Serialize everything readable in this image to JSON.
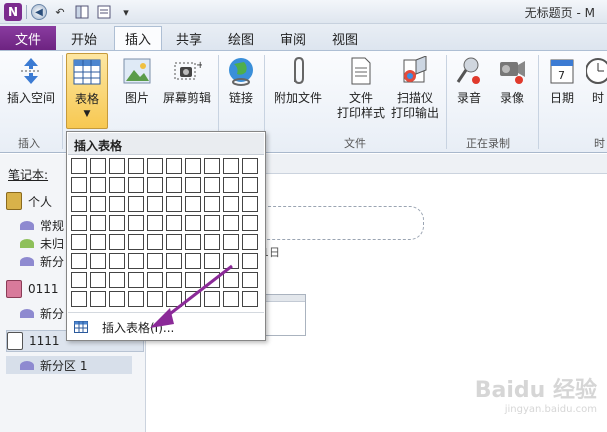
{
  "titlebar": {
    "window_title": "无标题页 - M"
  },
  "tabs": {
    "file": "文件",
    "items": [
      "开始",
      "插入",
      "共享",
      "绘图",
      "审阅",
      "视图"
    ],
    "active": "插入"
  },
  "ribbon": {
    "buttons": {
      "insert_space": "插入空间",
      "table": "表格",
      "picture": "图片",
      "screen_clip": "屏幕剪辑",
      "link": "链接",
      "attach_file": "附加文件",
      "file_printout_line1": "文件",
      "file_printout_line2": "打印样式",
      "scanner_line1": "扫描仪",
      "scanner_line2": "打印输出",
      "record_audio": "录音",
      "record_video": "录像",
      "date": "日期",
      "time": "时"
    },
    "groups": {
      "insert": "插入",
      "files": "文件",
      "recording": "正在录制",
      "time_group": "时"
    }
  },
  "sidebar": {
    "header": "笔记本:",
    "notebooks": [
      {
        "name": "个人",
        "color": "#d8b24a"
      },
      {
        "name": "0111",
        "color": "#d87a9b"
      },
      {
        "name": "1111",
        "color": "#8a8a8a"
      }
    ],
    "personal_sections": [
      "常规",
      "未归",
      "新分"
    ],
    "s0111_sections": [
      "新分"
    ],
    "s1111_sections": [
      "新分区 1"
    ]
  },
  "page": {
    "date_fragment": "1日"
  },
  "dropdown": {
    "header": "插入表格",
    "grid_rows": 8,
    "grid_cols": 10,
    "menu_item": "插入表格(I)..."
  },
  "watermark": {
    "main": "Baidu 经验",
    "sub": "jingyan.baidu.com"
  }
}
